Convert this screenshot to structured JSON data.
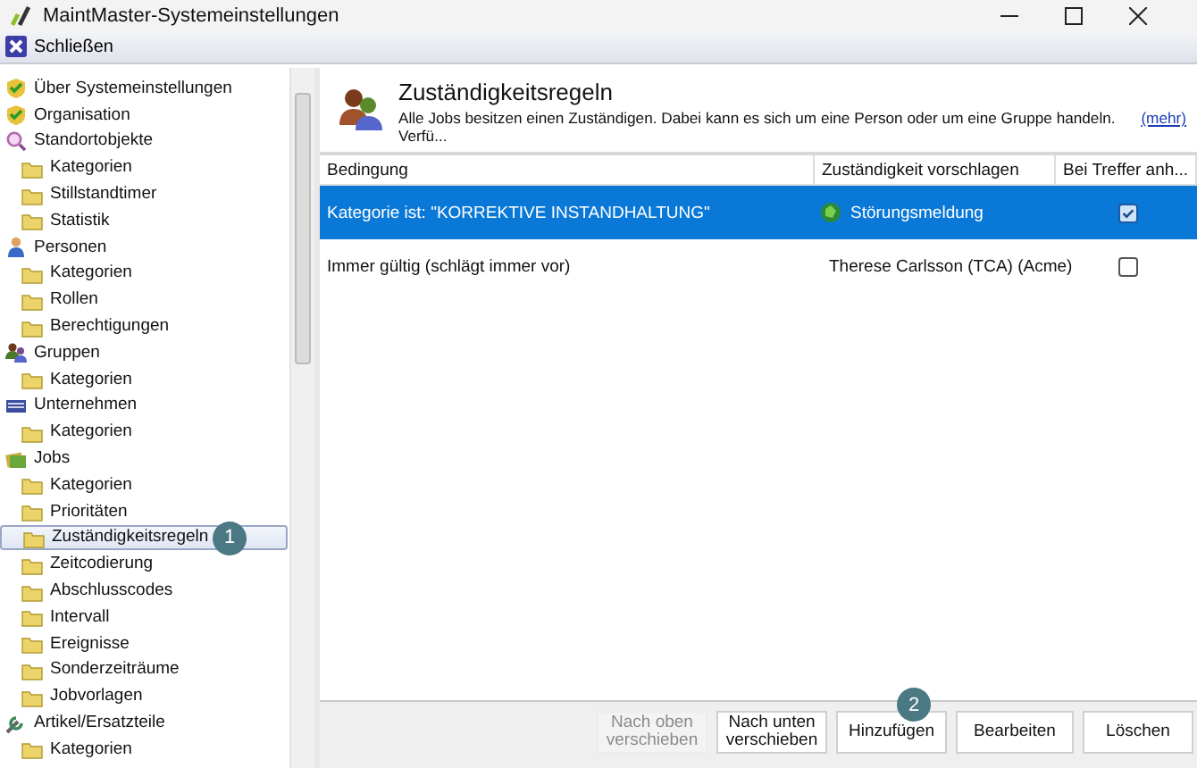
{
  "window": {
    "title": "MaintMaster-Systemeinstellungen"
  },
  "toolbar": {
    "close_label": "Schließen"
  },
  "tree": [
    {
      "label": "Über Systemeinstellungen",
      "selected": false
    },
    {
      "label": "Organisation",
      "selected": false
    },
    {
      "label": "Standortobjekte",
      "selected": false,
      "children": [
        {
          "label": "Kategorien",
          "selected": false
        },
        {
          "label": "Stillstandtimer",
          "selected": false
        },
        {
          "label": "Statistik",
          "selected": false
        }
      ]
    },
    {
      "label": "Personen",
      "selected": false,
      "children": [
        {
          "label": "Kategorien",
          "selected": false
        },
        {
          "label": "Rollen",
          "selected": false
        },
        {
          "label": "Berechtigungen",
          "selected": false
        }
      ]
    },
    {
      "label": "Gruppen",
      "selected": false,
      "children": [
        {
          "label": "Kategorien",
          "selected": false
        }
      ]
    },
    {
      "label": "Unternehmen",
      "selected": false,
      "children": [
        {
          "label": "Kategorien",
          "selected": false
        }
      ]
    },
    {
      "label": "Jobs",
      "selected": false,
      "children": [
        {
          "label": "Kategorien",
          "selected": false
        },
        {
          "label": "Prioritäten",
          "selected": false
        },
        {
          "label": "Zuständigkeitsregeln",
          "selected": true,
          "callout": "1"
        },
        {
          "label": "Zeitcodierung",
          "selected": false
        },
        {
          "label": "Abschlusscodes",
          "selected": false
        },
        {
          "label": "Intervall",
          "selected": false
        },
        {
          "label": "Ereignisse",
          "selected": false
        },
        {
          "label": "Sonderzeiträume",
          "selected": false
        },
        {
          "label": "Jobvorlagen",
          "selected": false
        }
      ]
    },
    {
      "label": "Artikel/Ersatzteile",
      "selected": false,
      "children": [
        {
          "label": "Kategorien",
          "selected": false
        }
      ]
    }
  ],
  "header": {
    "title": "Zuständigkeitsregeln",
    "description": "Alle Jobs besitzen einen Zuständigen. Dabei kann es sich um eine Person oder um eine Gruppe handeln. Verfü...",
    "more_link": "(mehr)"
  },
  "table": {
    "columns": [
      "Bedingung",
      "Zuständigkeit vorschlagen",
      "Bei Treffer anh..."
    ],
    "rows": [
      {
        "condition": "Kategorie ist: \"KORREKTIVE INSTANDHALTUNG\"",
        "kind": "group",
        "assignee": "Störungsmeldung",
        "checked": true,
        "selected": true
      },
      {
        "condition": "Immer gültig (schlägt immer vor)",
        "kind": "person",
        "assignee": "Therese Carlsson (TCA) (Acme)",
        "checked": false,
        "selected": false
      }
    ]
  },
  "buttons": [
    {
      "label": "Nach oben verschieben",
      "disabled": true
    },
    {
      "label": "Nach unten verschieben",
      "disabled": false
    },
    {
      "label": "Hinzufügen",
      "disabled": false,
      "callout": "2"
    },
    {
      "label": "Bearbeiten",
      "disabled": false
    },
    {
      "label": "Löschen",
      "disabled": false
    }
  ]
}
